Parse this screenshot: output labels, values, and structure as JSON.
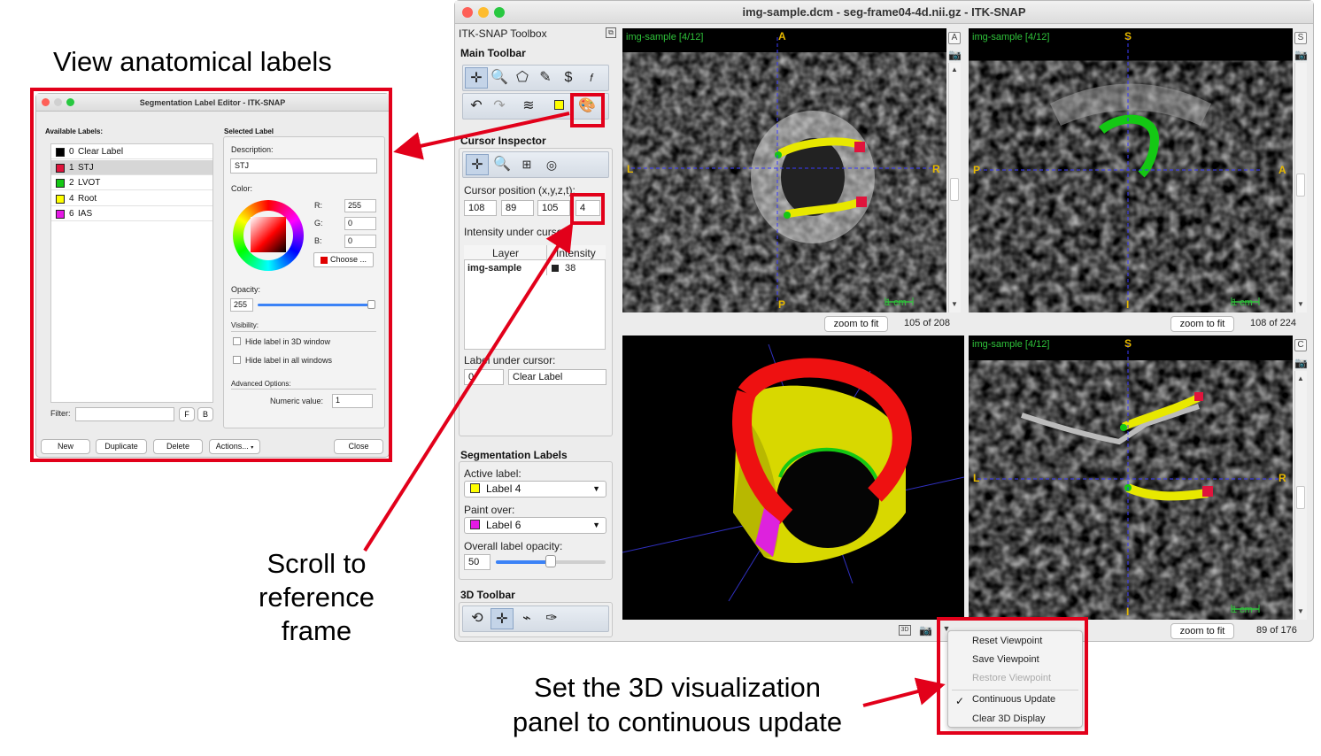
{
  "captions": {
    "view_labels": "View anatomical labels",
    "scroll": [
      "Scroll to",
      "reference",
      "frame"
    ],
    "set3d": [
      "Set the 3D visualization",
      "panel to continuous update"
    ]
  },
  "colors": {
    "annotation_red": "#e2001a",
    "overlay_green": "#2fc23a",
    "orient_yellow": "#e6b800"
  },
  "main_window": {
    "title": "img-sample.dcm - seg-frame04-4d.nii.gz - ITK-SNAP",
    "toolbox_title": "ITK-SNAP Toolbox",
    "main_toolbar_title": "Main Toolbar",
    "main_tools": [
      "crosshair-icon",
      "zoom-icon",
      "polygon-icon",
      "paintbrush-icon",
      "snake-icon",
      "annotation-icon"
    ],
    "main_tools_row2": [
      "undo-icon",
      "redo-icon",
      "layers-icon",
      "label-icon",
      "palette-icon"
    ],
    "cursor_inspector": {
      "title": "Cursor Inspector",
      "tools": [
        "crosshair-icon",
        "zoom-icon",
        "table-icon",
        "broadcast-icon"
      ],
      "position_label": "Cursor position (x,y,z,t):",
      "position": [
        "108",
        "89",
        "105",
        "4"
      ],
      "intensity_label": "Intensity under cursor:",
      "col_layer": "Layer",
      "col_intensity": "Intensity",
      "layer_name": "img-sample",
      "layer_value": "38",
      "label_under_label": "Label under cursor:",
      "label_under_id": "0",
      "label_under_name": "Clear Label"
    },
    "seg_labels": {
      "title": "Segmentation Labels",
      "active_label": "Active label:",
      "active_value": "Label 4",
      "paint_over": "Paint over:",
      "paint_value": "Label 6",
      "opacity_label": "Overall label opacity:",
      "opacity_value": "50",
      "opacity_fraction": 0.5
    },
    "toolbar3d": {
      "title": "3D Toolbar",
      "tools": [
        "rotate-icon",
        "crosshair-icon",
        "scalpel-icon",
        "spray-icon"
      ]
    },
    "views": {
      "axial": {
        "tag": "img-sample [4/12]",
        "top": "A",
        "bottom": "P",
        "left": "L",
        "right": "R",
        "scale": "1 cm",
        "zoom": "zoom to fit",
        "slice": "105 of 208",
        "side": "A"
      },
      "sagittal": {
        "tag": "img-sample [4/12]",
        "top": "S",
        "bottom": "I",
        "left": "P",
        "right": "A",
        "scale": "1 cm",
        "zoom": "zoom to fit",
        "slice": "108 of 224",
        "side": "S"
      },
      "coronal": {
        "tag": "img-sample [4/12]",
        "top": "S",
        "bottom": "I",
        "left": "L",
        "right": "R",
        "scale": "1 cm",
        "zoom": "zoom to fit",
        "slice": "89 of 176",
        "side": "C"
      }
    }
  },
  "view3d_menu": {
    "items": [
      "Reset Viewpoint",
      "Save Viewpoint",
      "Restore Viewpoint",
      "Continuous Update",
      "Clear 3D Display"
    ],
    "checkmark": "✓"
  },
  "label_editor": {
    "title": "Segmentation Label Editor - ITK-SNAP",
    "available_title": "Available Labels:",
    "labels": [
      {
        "id": "0",
        "name": "Clear Label",
        "color": "#000000"
      },
      {
        "id": "1",
        "name": "STJ",
        "color": "#e0143c"
      },
      {
        "id": "2",
        "name": "LVOT",
        "color": "#14c814"
      },
      {
        "id": "4",
        "name": "Root",
        "color": "#ffff00"
      },
      {
        "id": "6",
        "name": "IAS",
        "color": "#e619e6"
      }
    ],
    "filter_label": "Filter:",
    "filter_f": "F",
    "filter_b": "B",
    "selected_title": "Selected Label",
    "description_label": "Description:",
    "description_value": "STJ",
    "color_label": "Color:",
    "r_label": "R:",
    "g_label": "G:",
    "b_label": "B:",
    "r_value": "255",
    "g_value": "0",
    "b_value": "0",
    "choose": "Choose ...",
    "opacity_label": "Opacity:",
    "opacity_value": "255",
    "visibility_label": "Visibility:",
    "hide3d": "Hide label in 3D window",
    "hideall": "Hide label in all windows",
    "advanced": "Advanced Options:",
    "numeric_label": "Numeric value:",
    "numeric_value": "1",
    "buttons": {
      "new": "New",
      "duplicate": "Duplicate",
      "delete": "Delete",
      "actions": "Actions...",
      "close": "Close"
    }
  }
}
